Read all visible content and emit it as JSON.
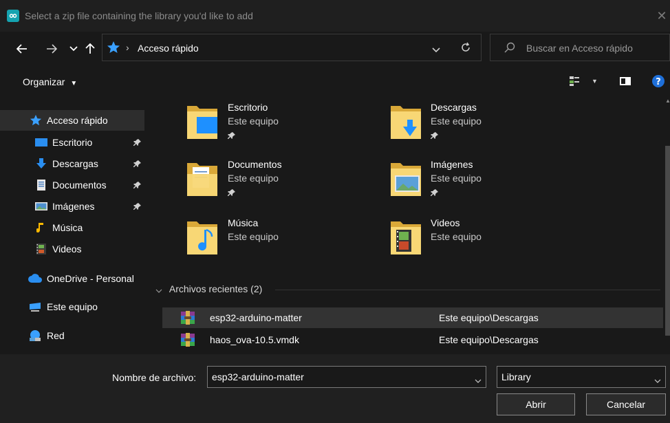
{
  "window": {
    "title": "Select a zip file containing the library you'd like to add",
    "app_icon": "infinity-icon",
    "close_icon": "close-icon"
  },
  "nav": {
    "back_icon": "arrow-left-icon",
    "forward_icon": "arrow-right-icon",
    "recent_icon": "chevron-down-icon",
    "up_icon": "arrow-up-icon",
    "location_icon": "star-icon",
    "breadcrumb_sep": "›",
    "address": "Acceso rápido",
    "refresh_icon": "refresh-icon",
    "search_placeholder": "Buscar en Acceso rápido"
  },
  "toolbar": {
    "organize": "Organizar",
    "view_icon": "view-options-icon",
    "preview_icon": "preview-pane-icon",
    "help_icon": "help-icon"
  },
  "sidebar": {
    "items": [
      {
        "label": "Acceso rápido",
        "icon": "star-icon",
        "pinned": false,
        "selected": true
      },
      {
        "label": "Escritorio",
        "icon": "desktop-icon",
        "pinned": true
      },
      {
        "label": "Descargas",
        "icon": "download-icon",
        "pinned": true
      },
      {
        "label": "Documentos",
        "icon": "document-icon",
        "pinned": true
      },
      {
        "label": "Imágenes",
        "icon": "pictures-icon",
        "pinned": true
      },
      {
        "label": "Música",
        "icon": "music-icon",
        "pinned": false
      },
      {
        "label": "Videos",
        "icon": "video-icon",
        "pinned": false
      },
      {
        "label": "OneDrive - Personal",
        "icon": "cloud-icon",
        "pinned": false
      },
      {
        "label": "Este equipo",
        "icon": "computer-icon",
        "pinned": false
      },
      {
        "label": "Red",
        "icon": "network-icon",
        "pinned": false
      }
    ]
  },
  "folders": [
    {
      "name": "Escritorio",
      "location": "Este equipo",
      "pinned": true,
      "icon": "desktop-folder-icon"
    },
    {
      "name": "Descargas",
      "location": "Este equipo",
      "pinned": true,
      "icon": "downloads-folder-icon"
    },
    {
      "name": "Documentos",
      "location": "Este equipo",
      "pinned": true,
      "icon": "documents-folder-icon"
    },
    {
      "name": "Imágenes",
      "location": "Este equipo",
      "pinned": true,
      "icon": "pictures-folder-icon"
    },
    {
      "name": "Música",
      "location": "Este equipo",
      "pinned": false,
      "icon": "music-folder-icon"
    },
    {
      "name": "Videos",
      "location": "Este equipo",
      "pinned": false,
      "icon": "videos-folder-icon"
    }
  ],
  "recent": {
    "header": "Archivos recientes (2)",
    "files": [
      {
        "name": "esp32-arduino-matter",
        "path": "Este equipo\\Descargas",
        "icon": "archive-icon",
        "selected": true
      },
      {
        "name": "haos_ova-10.5.vmdk",
        "path": "Este equipo\\Descargas",
        "icon": "archive-icon",
        "selected": false
      }
    ]
  },
  "footer": {
    "filename_label": "Nombre de archivo:",
    "filename_value": "esp32-arduino-matter",
    "filter_value": "Library",
    "open_label": "Abrir",
    "cancel_label": "Cancelar"
  }
}
